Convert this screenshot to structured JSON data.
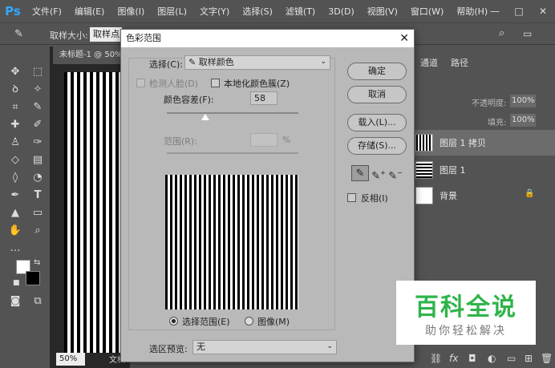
{
  "app": {
    "logo": "Ps"
  },
  "menu": [
    "文件(F)",
    "编辑(E)",
    "图像(I)",
    "图层(L)",
    "文字(Y)",
    "选择(S)",
    "滤镜(T)",
    "3D(D)",
    "视图(V)",
    "窗口(W)",
    "帮助(H)"
  ],
  "window_controls": {
    "minimize": "—",
    "maximize": "□",
    "close": "✕"
  },
  "options_bar": {
    "sample_size_label": "取样大小:",
    "sample_size_value": "取样点"
  },
  "document": {
    "tab_title": "未标题-1 @ 50%",
    "zoom": "50%",
    "status": "文档"
  },
  "panels": {
    "tabs": [
      "通道",
      "路径"
    ],
    "opacity_label": "不透明度:",
    "opacity_value": "100%",
    "fill_label": "填充:",
    "fill_value": "100%",
    "layers": [
      {
        "name": "图层 1 拷贝",
        "thumb": "stripes-v"
      },
      {
        "name": "图层 1",
        "thumb": "stripes-h"
      },
      {
        "name": "背景",
        "thumb": "white",
        "locked": true
      }
    ]
  },
  "dialog": {
    "title": "色彩范围",
    "close": "✕",
    "select_label": "选择(C):",
    "select_value": "取样颜色",
    "detect_faces": "检测人脸(D)",
    "localized_clusters": "本地化颜色簇(Z)",
    "fuzziness_label": "颜色容差(F):",
    "fuzziness_value": "58",
    "fuzziness_level": 0.29,
    "range_label": "范围(R):",
    "range_unit": "%",
    "buttons": {
      "ok": "确定",
      "cancel": "取消",
      "load": "载入(L)...",
      "save": "存储(S)..."
    },
    "invert": "反相(I)",
    "radio_selection": "选择范围(E)",
    "radio_image": "图像(M)",
    "preview_label": "选区预览:",
    "preview_value": "无"
  },
  "watermark": {
    "title": "百科全说",
    "subtitle": "助你轻松解决"
  }
}
